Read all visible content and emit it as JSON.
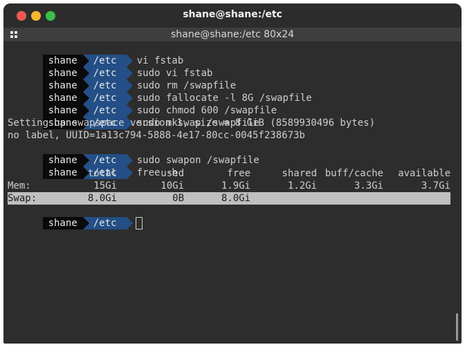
{
  "window": {
    "title": "shane@shane:/etc",
    "tab_title": "shane@shane:/etc 80x24"
  },
  "prompt": {
    "user": "shane",
    "dir": "/etc"
  },
  "commands": [
    "vi fstab",
    "sudo vi fstab",
    "sudo rm /swapfile",
    "sudo fallocate -l 8G /swapfile",
    "sudo chmod 600 /swapfile",
    "sudo mkswap /swapfile"
  ],
  "output": [
    "Setting up swapspace version 1, size = 8 GiB (8589930496 bytes)",
    "no label, UUID=1a13c794-5888-4e17-80cc-0045f238673b"
  ],
  "commands2": [
    "sudo swapon /swapfile",
    "free -h"
  ],
  "free": {
    "headers": {
      "total": "total",
      "used": "used",
      "free": "free",
      "shared": "shared",
      "buff": "buff/cache",
      "available": "available"
    },
    "mem": {
      "label": "Mem:",
      "total": "15Gi",
      "used": "10Gi",
      "free": "1.9Gi",
      "shared": "1.2Gi",
      "buff": "3.3Gi",
      "available": "3.7Gi"
    },
    "swap": {
      "label": "Swap:",
      "total": "8.0Gi",
      "used": "0B",
      "free": "8.0Gi"
    }
  },
  "colors": {
    "dir_segment": "#234f86",
    "user_segment": "#0a0a0a",
    "terminal_bg": "#2d2d2d"
  }
}
